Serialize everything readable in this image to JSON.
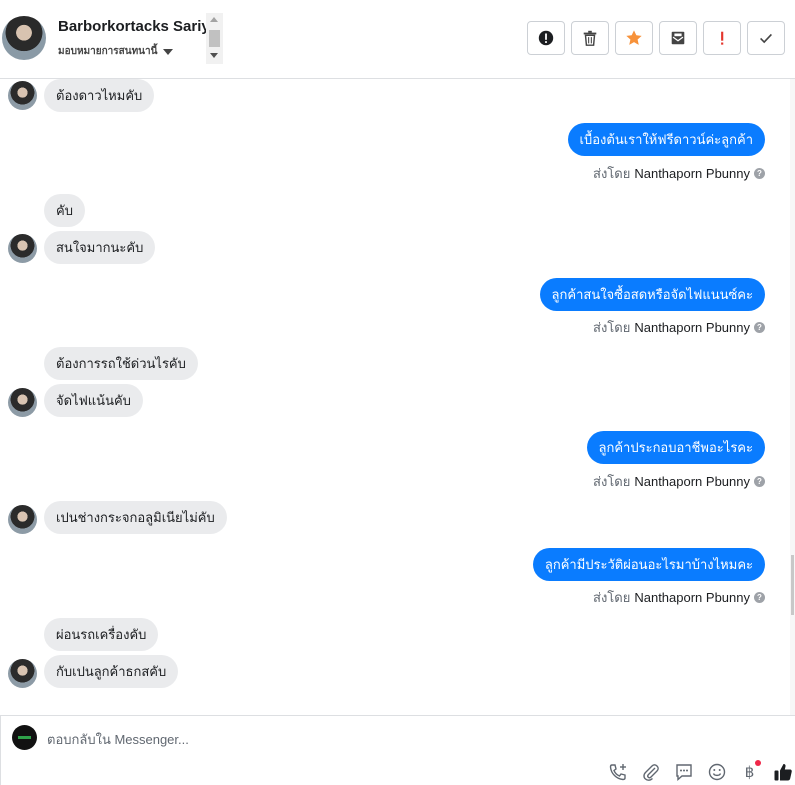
{
  "header": {
    "contact_name": "Barborkortacks Sariyas",
    "contact_subtitle": "มอบหมายการสนทนานี้",
    "toolbar": [
      {
        "name": "report-spam-button",
        "icon": "alert-circle-icon"
      },
      {
        "name": "delete-button",
        "icon": "trash-icon"
      },
      {
        "name": "star-button",
        "icon": "star-icon"
      },
      {
        "name": "mark-unread-button",
        "icon": "envelope-icon"
      },
      {
        "name": "follow-up-button",
        "icon": "exclamation-icon"
      },
      {
        "name": "mark-done-button",
        "icon": "check-icon"
      }
    ]
  },
  "messages": [
    {
      "dir": "in",
      "text": "ต้องดาวไหมคับ",
      "avatar": true
    },
    {
      "dir": "out",
      "text": "เบื้องต้นเราให้ฟรีดาวน์ค่ะลูกค้า"
    },
    {
      "sent_by": "ส่งโดย",
      "sender": "Nanthaporn Pbunny"
    },
    {
      "dir": "in",
      "text": "คับ",
      "avatar": false
    },
    {
      "dir": "in",
      "text": "สนใจมากนะคับ",
      "avatar": true
    },
    {
      "dir": "out",
      "text": "ลูกค้าสนใจซื้อสดหรือจัดไฟแนนซ์คะ"
    },
    {
      "sent_by": "ส่งโดย",
      "sender": "Nanthaporn Pbunny"
    },
    {
      "dir": "in",
      "text": "ต้องการรถใช้ด่วนไรคับ",
      "avatar": false
    },
    {
      "dir": "in",
      "text": "จัดไฟแน้นคับ",
      "avatar": true
    },
    {
      "dir": "out",
      "text": "ลูกค้าประกอบอาชีพอะไรคะ"
    },
    {
      "sent_by": "ส่งโดย",
      "sender": "Nanthaporn Pbunny"
    },
    {
      "dir": "in",
      "text": "เปนช่างกระจกอลูมิเนียไม่คับ",
      "avatar": true
    },
    {
      "dir": "out",
      "text": "ลูกค้ามีประวัติผ่อนอะไรมาบ้างไหมคะ"
    },
    {
      "sent_by": "ส่งโดย",
      "sender": "Nanthaporn Pbunny"
    },
    {
      "dir": "in",
      "text": "ผ่อนรถเครื่องคับ",
      "avatar": false
    },
    {
      "dir": "in",
      "text": "กับเปนลูกค้าธกสคับ",
      "avatar": true
    }
  ],
  "composer": {
    "placeholder": "ตอบกลับใน Messenger...",
    "icons": [
      "phone-add-icon",
      "paperclip-icon",
      "saved-reply-icon",
      "emoji-icon",
      "baht-icon",
      "thumbs-up-icon"
    ],
    "baht_symbol": "฿"
  }
}
